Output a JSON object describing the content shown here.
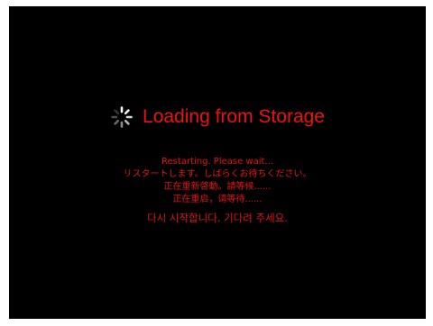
{
  "screen": {
    "background": "#000000",
    "accent": "#ee1111",
    "spinner_icon": "spinner-icon",
    "title": "Loading from Storage",
    "messages": [
      "Restarting. Please wait...",
      "リスタートします。しばらくお待ちください。",
      "正在重新啓動。請等候......",
      "正在重启，请等待......",
      "다시 시작합니다. 기다려 주세요."
    ]
  }
}
